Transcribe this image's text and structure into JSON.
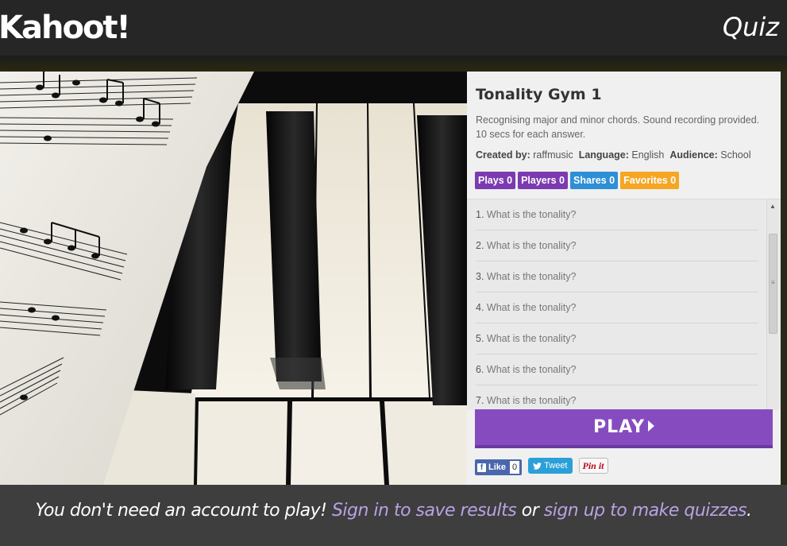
{
  "header": {
    "logo": "Kahoot!",
    "section_label": "Quiz"
  },
  "quiz": {
    "title": "Tonality Gym 1",
    "description": "Recognising major and minor chords. Sound recording provided. 10 secs for each answer.",
    "created_by_label": "Created by:",
    "created_by": "raffmusic",
    "language_label": "Language:",
    "language": "English",
    "audience_label": "Audience:",
    "audience": "School",
    "stats": {
      "plays": "Plays 0",
      "players": "Players 0",
      "shares": "Shares 0",
      "favorites": "Favorites 0"
    },
    "questions": [
      {
        "num": "1.",
        "text": "What is the tonality?"
      },
      {
        "num": "2.",
        "text": "What is the tonality?"
      },
      {
        "num": "3.",
        "text": "What is the tonality?"
      },
      {
        "num": "4.",
        "text": "What is the tonality?"
      },
      {
        "num": "5.",
        "text": "What is the tonality?"
      },
      {
        "num": "6.",
        "text": "What is the tonality?"
      },
      {
        "num": "7.",
        "text": "What is the tonality?"
      }
    ],
    "play_label": "PLAY"
  },
  "social": {
    "like_label": "Like",
    "like_count": "0",
    "tweet_label": "Tweet",
    "pin_label": "Pin it"
  },
  "footer": {
    "text_a": "You don't need an account to play!",
    "link_signin": "Sign in to save results",
    "text_b": "or",
    "link_signup": "sign up to make quizzes",
    "text_c": "."
  },
  "colors": {
    "purple": "#864cbf",
    "badge_purple": "#7c3ab0",
    "badge_blue": "#2f8fd6",
    "badge_orange": "#f5a623",
    "link": "#b9a2e3"
  }
}
